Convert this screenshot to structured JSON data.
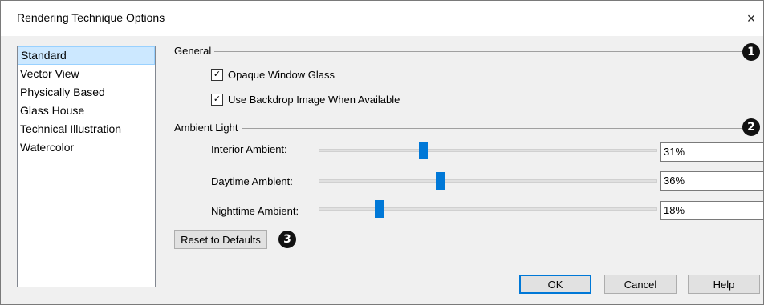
{
  "window": {
    "title": "Rendering Technique Options",
    "close_glyph": "×"
  },
  "techniques": {
    "items": [
      {
        "label": "Standard",
        "selected": true
      },
      {
        "label": "Vector View",
        "selected": false
      },
      {
        "label": "Physically Based",
        "selected": false
      },
      {
        "label": "Glass House",
        "selected": false
      },
      {
        "label": "Technical Illustration",
        "selected": false
      },
      {
        "label": "Watercolor",
        "selected": false
      }
    ]
  },
  "general": {
    "label": "General",
    "badge": "1",
    "opaque_glass": {
      "label": "Opaque Window Glass",
      "checked": true
    },
    "backdrop": {
      "label": "Use Backdrop Image When Available",
      "checked": true
    }
  },
  "ambient": {
    "label": "Ambient Light",
    "badge": "2",
    "interior": {
      "label": "Interior Ambient:",
      "value": "31%",
      "level": 0.31
    },
    "daytime": {
      "label": "Daytime Ambient:",
      "value": "36%",
      "level": 0.36
    },
    "nighttime": {
      "label": "Nighttime Ambient:",
      "value": "18%",
      "level": 0.18
    }
  },
  "reset": {
    "label": "Reset to Defaults",
    "badge": "3"
  },
  "footer": {
    "ok": "OK",
    "cancel": "Cancel",
    "help": "Help"
  },
  "colors": {
    "accent": "#0078d7",
    "selection": "#cce8ff"
  }
}
